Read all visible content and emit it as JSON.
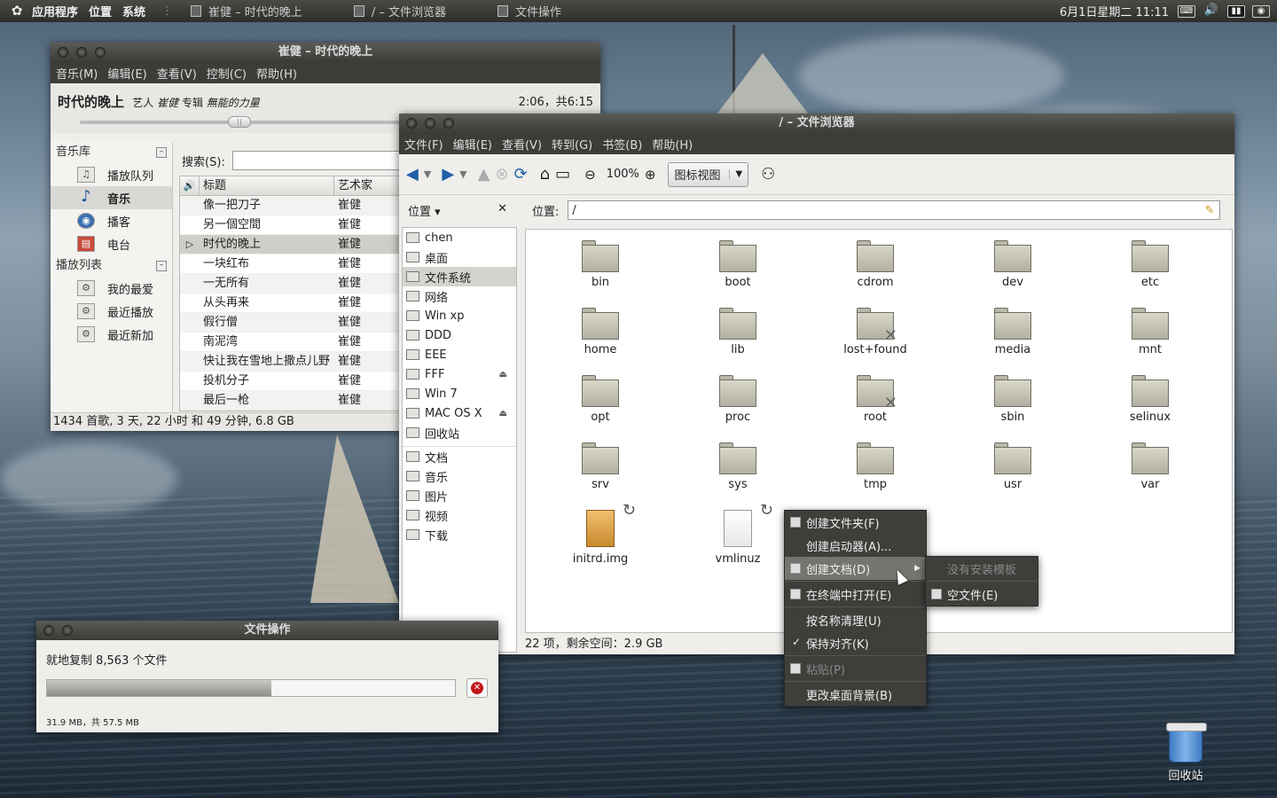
{
  "panel": {
    "menus": [
      "应用程序",
      "位置",
      "系统"
    ],
    "tasks": [
      "崔健 – 时代的晚上",
      "/ – 文件浏览器",
      "文件操作"
    ],
    "clock": "6月1日星期二 11:11"
  },
  "rhythmbox": {
    "title": "崔健 – 时代的晚上",
    "menus": [
      "音乐(M)",
      "编辑(E)",
      "查看(V)",
      "控制(C)",
      "帮助(H)"
    ],
    "now_playing": {
      "song": "时代的晚上",
      "artist_label": "艺人",
      "artist": "崔健",
      "album_label": "专辑",
      "album": "無能的力量",
      "time": "2:06，共6:15"
    },
    "progress": 0.337,
    "library_header": "音乐库",
    "library": [
      {
        "label": "播放队列",
        "icon": "queue-icon"
      },
      {
        "label": "音乐",
        "icon": "music-note-icon"
      },
      {
        "label": "播客",
        "icon": "podcast-icon"
      },
      {
        "label": "电台",
        "icon": "radio-icon"
      }
    ],
    "playlist_header": "播放列表",
    "playlists": [
      "我的最爱",
      "最近播放",
      "最近新加"
    ],
    "search_label": "搜索(S):",
    "search_value": "",
    "columns": {
      "title": "标题",
      "artist": "艺术家"
    },
    "tracks": [
      {
        "title": "像一把刀子",
        "artist": "崔健"
      },
      {
        "title": "另一個空間",
        "artist": "崔健"
      },
      {
        "title": "时代的晚上",
        "artist": "崔健",
        "playing": true
      },
      {
        "title": "一块红布",
        "artist": "崔健"
      },
      {
        "title": "一无所有",
        "artist": "崔健"
      },
      {
        "title": "从头再来",
        "artist": "崔健"
      },
      {
        "title": "假行僧",
        "artist": "崔健"
      },
      {
        "title": "南泥湾",
        "artist": "崔健"
      },
      {
        "title": "快让我在雪地上撒点儿野",
        "artist": "崔健"
      },
      {
        "title": "投机分子",
        "artist": "崔健"
      },
      {
        "title": "最后一枪",
        "artist": "崔健"
      }
    ],
    "status": "1434 首歌, 3 天, 22 小时 和 49 分钟, 6.8 GB"
  },
  "filebrowser": {
    "title": "/ – 文件浏览器",
    "menus": [
      "文件(F)",
      "编辑(E)",
      "查看(V)",
      "转到(G)",
      "书签(B)",
      "帮助(H)"
    ],
    "zoom": "100%",
    "view_mode": "图标视图",
    "places_label": "位置",
    "location_label": "位置:",
    "location_value": "/",
    "places": [
      {
        "label": "chen"
      },
      {
        "label": "桌面"
      },
      {
        "label": "文件系统",
        "selected": true
      },
      {
        "label": "网络"
      },
      {
        "label": "Win xp"
      },
      {
        "label": "DDD"
      },
      {
        "label": "EEE"
      },
      {
        "label": "FFF",
        "eject": true
      },
      {
        "label": "Win 7"
      },
      {
        "label": "MAC OS X",
        "eject": true
      },
      {
        "label": "回收站"
      }
    ],
    "bookmarks": [
      "文档",
      "音乐",
      "图片",
      "视频",
      "下载"
    ],
    "files": [
      {
        "name": "bin",
        "type": "folder"
      },
      {
        "name": "boot",
        "type": "folder"
      },
      {
        "name": "cdrom",
        "type": "folder"
      },
      {
        "name": "dev",
        "type": "folder"
      },
      {
        "name": "etc",
        "type": "folder"
      },
      {
        "name": "home",
        "type": "folder"
      },
      {
        "name": "lib",
        "type": "folder"
      },
      {
        "name": "lost+found",
        "type": "folder-locked"
      },
      {
        "name": "media",
        "type": "folder"
      },
      {
        "name": "mnt",
        "type": "folder"
      },
      {
        "name": "opt",
        "type": "folder"
      },
      {
        "name": "proc",
        "type": "folder"
      },
      {
        "name": "root",
        "type": "folder-locked"
      },
      {
        "name": "sbin",
        "type": "folder"
      },
      {
        "name": "selinux",
        "type": "folder"
      },
      {
        "name": "srv",
        "type": "folder"
      },
      {
        "name": "sys",
        "type": "folder"
      },
      {
        "name": "tmp",
        "type": "folder"
      },
      {
        "name": "usr",
        "type": "folder"
      },
      {
        "name": "var",
        "type": "folder"
      },
      {
        "name": "initrd.img",
        "type": "link-image"
      },
      {
        "name": "vmlinuz",
        "type": "link-file"
      }
    ],
    "status": "22 项，剩余空间：2.9 GB"
  },
  "fileop": {
    "title": "文件操作",
    "message": "就地复制 8,563 个文件",
    "progress": 0.55,
    "detail": "31.9 MB，共 57.5 MB"
  },
  "context_menu": [
    {
      "label": "创建文件夹(F)",
      "icon": "new-folder-icon"
    },
    {
      "label": "创建启动器(A)..."
    },
    {
      "label": "创建文档(D)",
      "highlighted": true,
      "submenu": true,
      "icon": "new-document-icon"
    },
    {
      "divider": true
    },
    {
      "label": "在终端中打开(E)",
      "icon": "terminal-icon"
    },
    {
      "divider": true
    },
    {
      "label": "按名称清理(U)"
    },
    {
      "label": "保持对齐(K)",
      "checked": true
    },
    {
      "divider": true
    },
    {
      "label": "粘贴(P)",
      "disabled": true,
      "icon": "paste-icon"
    },
    {
      "divider": true
    },
    {
      "label": "更改桌面背景(B)"
    }
  ],
  "submenu": [
    {
      "label": "没有安装模板",
      "disabled": true
    },
    {
      "divider": true
    },
    {
      "label": "空文件(E)",
      "icon": "empty-file-icon"
    }
  ],
  "desktop": {
    "trash_label": "回收站"
  }
}
